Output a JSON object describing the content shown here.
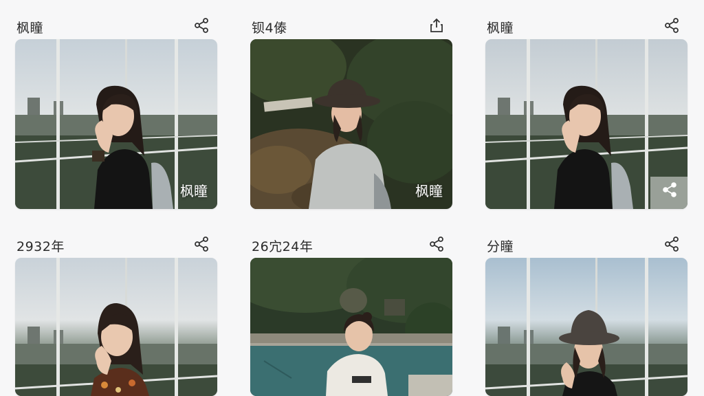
{
  "cards": [
    {
      "title": "枫瞳",
      "action_icon": "share-icon",
      "photo_subject": "woman-hand-on-cheek-rooftop-railing",
      "watermark": "枫瞳"
    },
    {
      "title": "钡4傣",
      "action_icon": "upload-share-icon",
      "photo_subject": "woman-bucket-hat-garden",
      "watermark": "枫瞳"
    },
    {
      "title": "枫瞳",
      "action_icon": "share-icon",
      "photo_subject": "woman-hand-on-cheek-rooftop-railing",
      "overlay_icon": "share-icon"
    },
    {
      "title": "2932年",
      "action_icon": "share-icon",
      "photo_subject": "woman-floral-top-rooftop-railing"
    },
    {
      "title": "26宂24年",
      "action_icon": "share-icon",
      "photo_subject": "woman-white-shirt-pool-garden"
    },
    {
      "title": "分瞳",
      "action_icon": "share-icon",
      "photo_subject": "woman-bucket-hat-rooftop-railing"
    }
  ],
  "colors": {
    "background": "#f7f7f8",
    "title_text": "#2a2a2a",
    "icon": "#333333",
    "watermark_text": "#ffffff"
  }
}
